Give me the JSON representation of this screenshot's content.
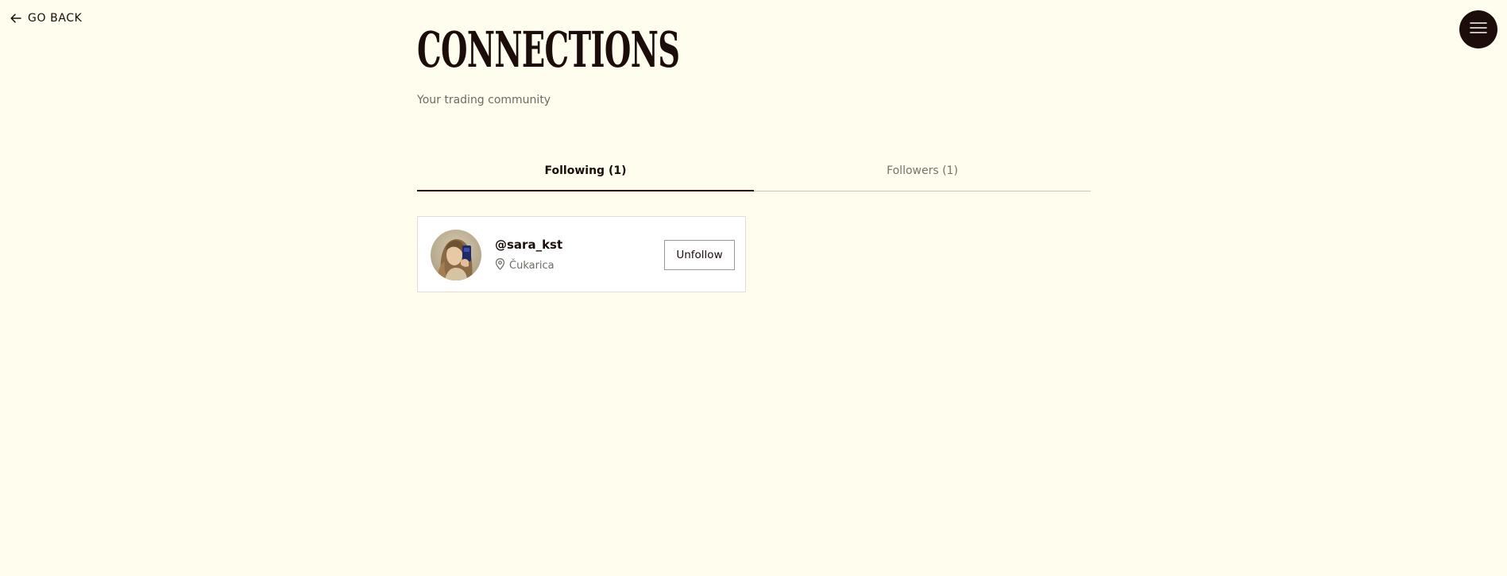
{
  "nav": {
    "back_label": "GO BACK",
    "back_icon": "arrow-left-icon",
    "menu_icon": "hamburger-icon"
  },
  "header": {
    "title": "Connections",
    "subtitle": "Your trading community"
  },
  "tabs": [
    {
      "label": "Following (1)",
      "active": true
    },
    {
      "label": "Followers (1)",
      "active": false
    }
  ],
  "connections": [
    {
      "username": "@sara_kst",
      "location": "Čukarica",
      "location_icon": "map-pin-icon",
      "action_label": "Unfollow"
    }
  ],
  "colors": {
    "background": "#fffdee",
    "accent": "#1c0d0a",
    "card": "#ffffff"
  }
}
